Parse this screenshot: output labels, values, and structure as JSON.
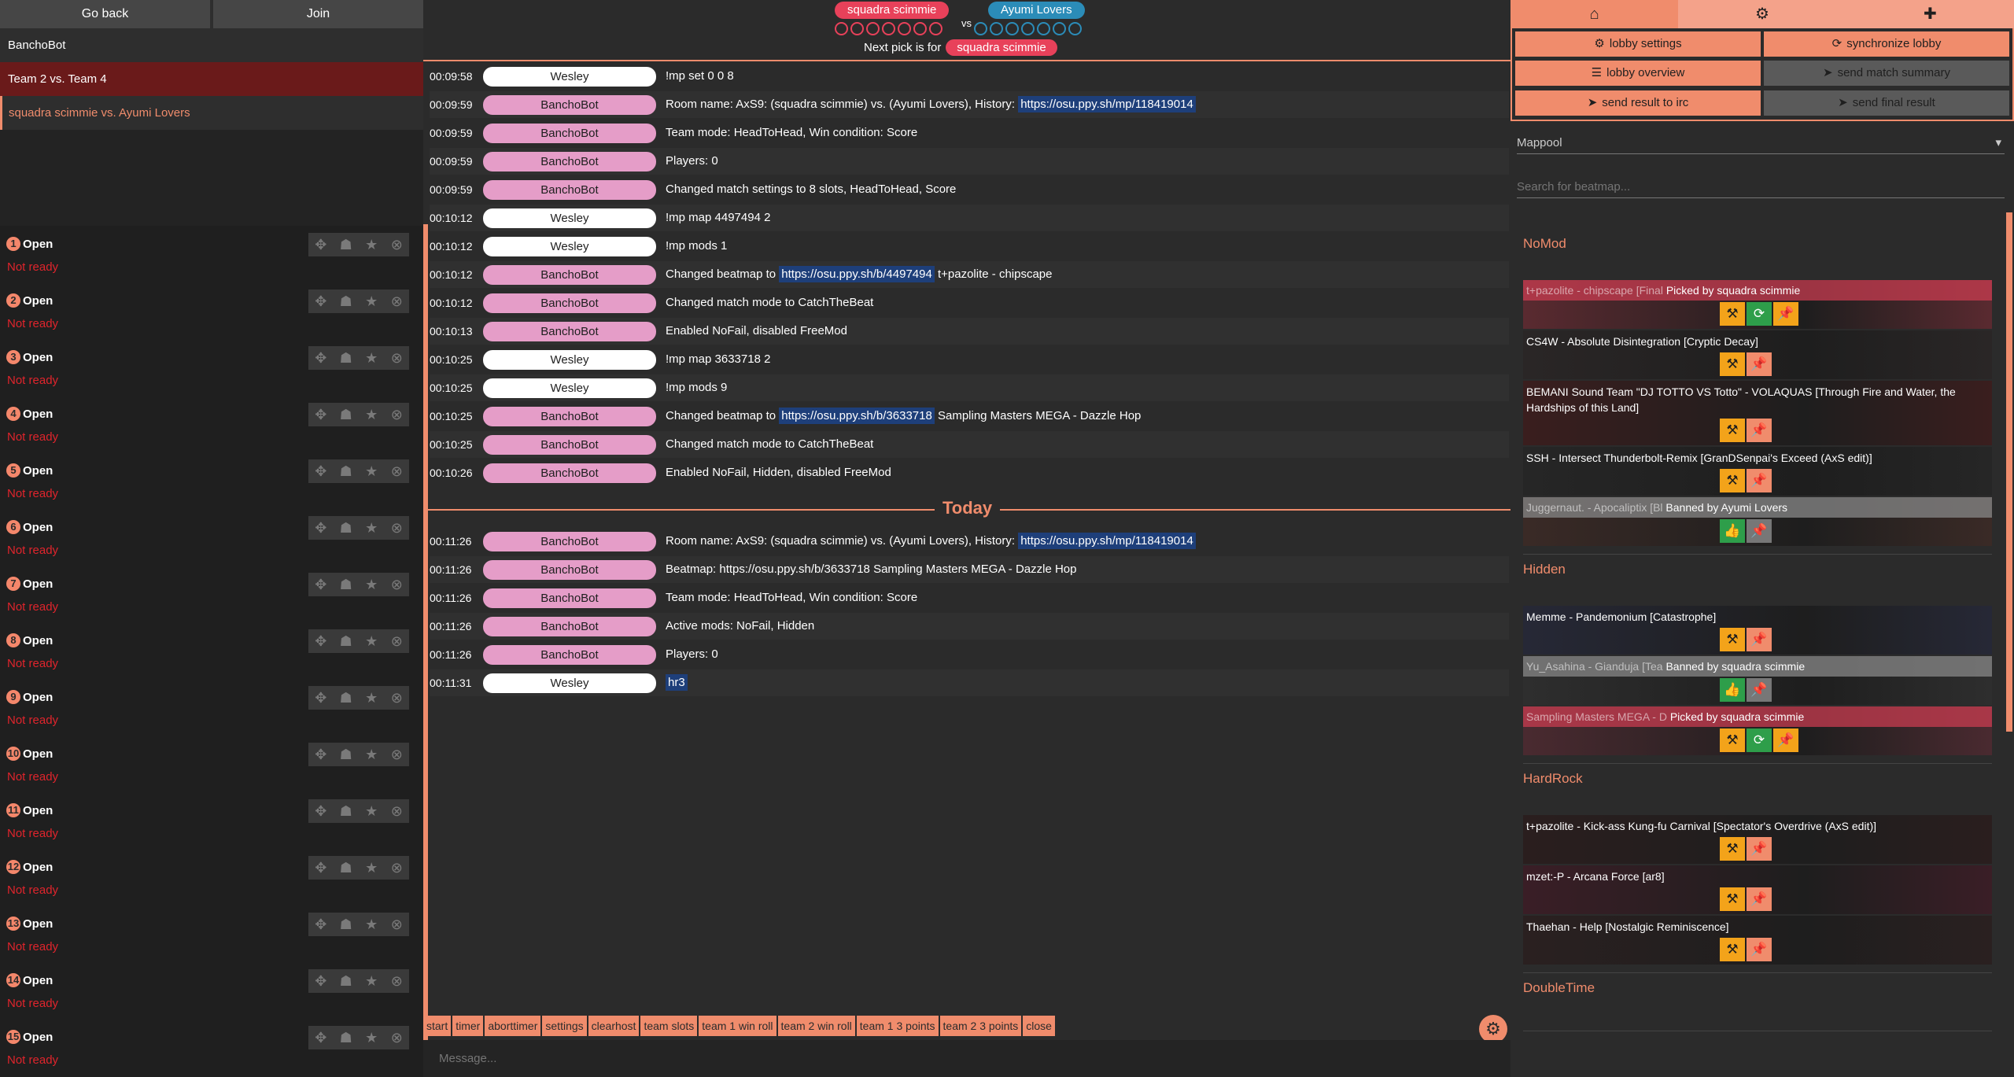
{
  "left": {
    "go_back": "Go back",
    "join": "Join",
    "channels": [
      "BanchoBot",
      "Team 2 vs. Team 4",
      "squadra scimmie vs. Ayumi Lovers"
    ],
    "slots": [
      {
        "num": "1",
        "label": "Open",
        "status": "Not ready"
      },
      {
        "num": "2",
        "label": "Open",
        "status": "Not ready"
      },
      {
        "num": "3",
        "label": "Open",
        "status": "Not ready"
      },
      {
        "num": "4",
        "label": "Open",
        "status": "Not ready"
      },
      {
        "num": "5",
        "label": "Open",
        "status": "Not ready"
      },
      {
        "num": "6",
        "label": "Open",
        "status": "Not ready"
      },
      {
        "num": "7",
        "label": "Open",
        "status": "Not ready"
      },
      {
        "num": "8",
        "label": "Open",
        "status": "Not ready"
      },
      {
        "num": "9",
        "label": "Open",
        "status": "Not ready"
      },
      {
        "num": "10",
        "label": "Open",
        "status": "Not ready"
      },
      {
        "num": "11",
        "label": "Open",
        "status": "Not ready"
      },
      {
        "num": "12",
        "label": "Open",
        "status": "Not ready"
      },
      {
        "num": "13",
        "label": "Open",
        "status": "Not ready"
      },
      {
        "num": "14",
        "label": "Open",
        "status": "Not ready"
      },
      {
        "num": "15",
        "label": "Open",
        "status": "Not ready"
      }
    ],
    "slot_icons": [
      "gamepad-icon",
      "team-icon",
      "star-icon",
      "close-icon"
    ]
  },
  "header": {
    "team1": "squadra scimmie",
    "team2": "Ayumi Lovers",
    "vs": "vs",
    "team1_color": "#e8415a",
    "team2_color": "#2b8cb8",
    "points_per_team": 7,
    "next_pick_label": "Next pick is for",
    "next_pick_team": "squadra scimmie"
  },
  "chat": {
    "messages": [
      {
        "time": "00:09:58",
        "nick": "Wesley",
        "text": "!mp set 0 0 8",
        "link": "",
        "after": ""
      },
      {
        "time": "00:09:59",
        "nick": "BanchoBot",
        "text": "Room name: AxS9: (squadra scimmie) vs. (Ayumi Lovers), History: ",
        "link": "https://osu.ppy.sh/mp/118419014",
        "after": ""
      },
      {
        "time": "00:09:59",
        "nick": "BanchoBot",
        "text": "Team mode: HeadToHead, Win condition: Score",
        "link": "",
        "after": ""
      },
      {
        "time": "00:09:59",
        "nick": "BanchoBot",
        "text": "Players: 0",
        "link": "",
        "after": ""
      },
      {
        "time": "00:09:59",
        "nick": "BanchoBot",
        "text": "Changed match settings to 8 slots, HeadToHead, Score",
        "link": "",
        "after": ""
      },
      {
        "time": "00:10:12",
        "nick": "Wesley",
        "text": "!mp map 4497494 2",
        "link": "",
        "after": ""
      },
      {
        "time": "00:10:12",
        "nick": "Wesley",
        "text": "!mp mods 1",
        "link": "",
        "after": ""
      },
      {
        "time": "00:10:12",
        "nick": "BanchoBot",
        "text": "Changed beatmap to ",
        "link": "https://osu.ppy.sh/b/4497494",
        "after": " t+pazolite - chipscape"
      },
      {
        "time": "00:10:12",
        "nick": "BanchoBot",
        "text": "Changed match mode to CatchTheBeat",
        "link": "",
        "after": ""
      },
      {
        "time": "00:10:13",
        "nick": "BanchoBot",
        "text": "Enabled NoFail, disabled FreeMod",
        "link": "",
        "after": ""
      },
      {
        "time": "00:10:25",
        "nick": "Wesley",
        "text": "!mp map 3633718 2",
        "link": "",
        "after": ""
      },
      {
        "time": "00:10:25",
        "nick": "Wesley",
        "text": "!mp mods 9",
        "link": "",
        "after": ""
      },
      {
        "time": "00:10:25",
        "nick": "BanchoBot",
        "text": "Changed beatmap to ",
        "link": "https://osu.ppy.sh/b/3633718",
        "after": " Sampling Masters MEGA - Dazzle Hop"
      },
      {
        "time": "00:10:25",
        "nick": "BanchoBot",
        "text": "Changed match mode to CatchTheBeat",
        "link": "",
        "after": ""
      },
      {
        "time": "00:10:26",
        "nick": "BanchoBot",
        "text": "Enabled NoFail, Hidden, disabled FreeMod",
        "link": "",
        "after": ""
      }
    ],
    "divider": "Today",
    "messages_today": [
      {
        "time": "00:11:26",
        "nick": "BanchoBot",
        "text": "Room name: AxS9: (squadra scimmie) vs. (Ayumi Lovers), History: ",
        "link": "https://osu.ppy.sh/mp/118419014",
        "after": ""
      },
      {
        "time": "00:11:26",
        "nick": "BanchoBot",
        "text": "Beatmap: https://osu.ppy.sh/b/3633718 Sampling Masters MEGA - Dazzle Hop",
        "link": "",
        "after": ""
      },
      {
        "time": "00:11:26",
        "nick": "BanchoBot",
        "text": "Team mode: HeadToHead, Win condition: Score",
        "link": "",
        "after": ""
      },
      {
        "time": "00:11:26",
        "nick": "BanchoBot",
        "text": "Active mods: NoFail, Hidden",
        "link": "",
        "after": ""
      },
      {
        "time": "00:11:26",
        "nick": "BanchoBot",
        "text": "Players: 0",
        "link": "",
        "after": ""
      },
      {
        "time": "00:11:31",
        "nick": "Wesley",
        "text": "",
        "link": "hr3",
        "after": ""
      }
    ],
    "commands": [
      "start",
      "timer",
      "aborttimer",
      "settings",
      "clearhost",
      "team slots",
      "team 1 win roll",
      "team 2 win roll",
      "team 1 3 points",
      "team 2 3 points",
      "close"
    ],
    "message_placeholder": "Message..."
  },
  "right": {
    "tabs": [
      "home-icon",
      "gear-icon",
      "add-user-icon"
    ],
    "actions": [
      {
        "label": "lobby settings",
        "icon": "⚙",
        "enabled": true
      },
      {
        "label": "synchronize lobby",
        "icon": "⟳",
        "enabled": true
      },
      {
        "label": "lobby overview",
        "icon": "☰",
        "enabled": true
      },
      {
        "label": "send match summary",
        "icon": "➤",
        "enabled": false
      },
      {
        "label": "send result to irc",
        "icon": "➤",
        "enabled": true
      },
      {
        "label": "send final result",
        "icon": "➤",
        "enabled": false
      }
    ],
    "mappool_label": "Mappool",
    "search_placeholder": "Search for beatmap...",
    "mods": [
      {
        "name": "NoMod",
        "beatmaps": [
          {
            "title": "t+pazolite - chipscape [Final",
            "state": "picked",
            "note": "Picked by squadra scimmie",
            "bg": "#5a2a30"
          },
          {
            "title": "CS4W - Absolute Disintegration [Cryptic Decay]",
            "state": "none",
            "note": "",
            "bg": "#2a2626"
          },
          {
            "title": "BEMANI Sound Team \"DJ TOTTO VS Totto\" - VOLAQUAS [Through Fire and Water, the Hardships of this Land]",
            "state": "none",
            "note": "",
            "bg": "#3a1e1e"
          },
          {
            "title": "SSH - Intersect Thunderbolt-Remix [GranDSenpai's Exceed (AxS edit)]",
            "state": "none",
            "note": "",
            "bg": "#262626"
          },
          {
            "title": "Juggernaut. - Apocaliptix [Bl",
            "state": "banned",
            "note": "Banned by Ayumi Lovers",
            "bg": "#3a2a26"
          }
        ]
      },
      {
        "name": "Hidden",
        "beatmaps": [
          {
            "title": "Memme - Pandemonium [Catastrophe]",
            "state": "none",
            "note": "",
            "bg": "#262836"
          },
          {
            "title": "Yu_Asahina - Gianduja [Tea",
            "state": "banned",
            "note": "Banned by squadra scimmie",
            "bg": "#2e2e2e"
          },
          {
            "title": "Sampling Masters MEGA - D",
            "state": "picked",
            "note": "Picked by squadra scimmie",
            "bg": "#4a2a30"
          }
        ]
      },
      {
        "name": "HardRock",
        "beatmaps": [
          {
            "title": "t+pazolite - Kick-ass Kung-fu Carnival [Spectator's Overdrive (AxS edit)]",
            "state": "none",
            "note": "",
            "bg": "#2a1e1e"
          },
          {
            "title": "mzet:-P - Arcana Force [ar8]",
            "state": "none",
            "note": "",
            "bg": "#3a1e26"
          },
          {
            "title": "Thaehan - Help [Nostalgic Reminiscence]",
            "state": "none",
            "note": "",
            "bg": "#2a2020"
          }
        ]
      },
      {
        "name": "DoubleTime",
        "beatmaps": []
      }
    ]
  },
  "colors": {
    "accent": "#f08c6c",
    "bot_pill": "#e59dc8",
    "not_ready": "#e0242c",
    "link_bg": "#1e3f7a"
  }
}
